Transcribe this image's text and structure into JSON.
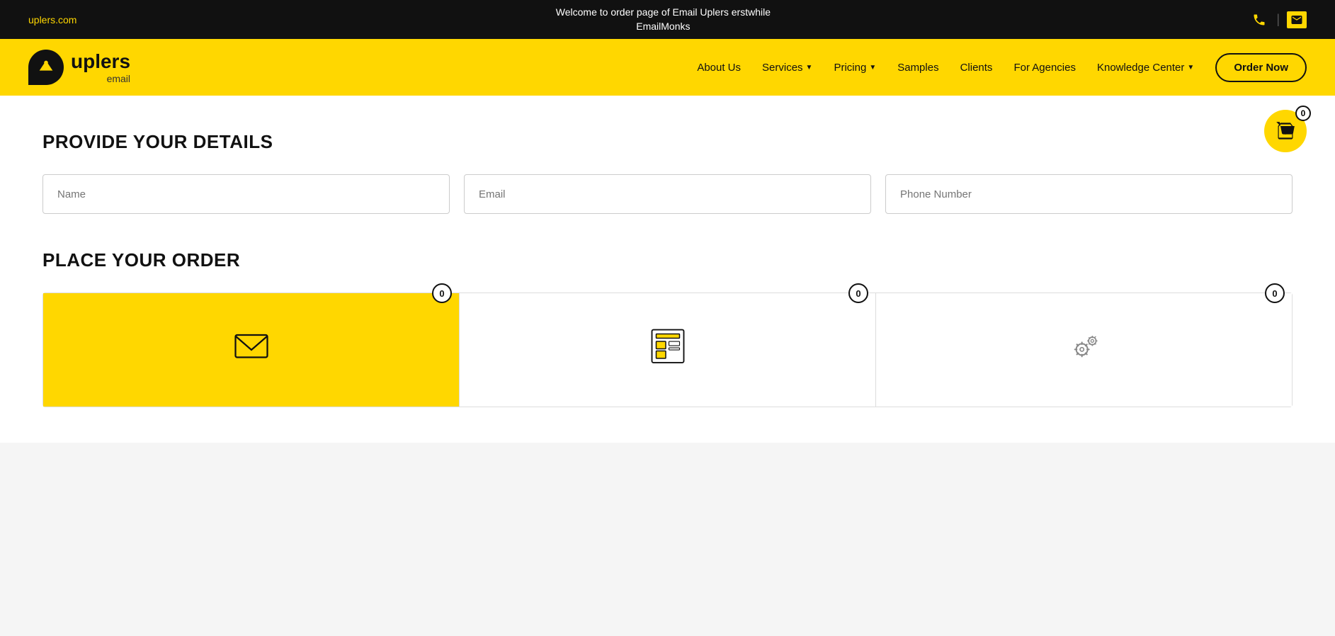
{
  "topBar": {
    "siteLink": "uplers.com",
    "welcomeMessage": "Welcome to order page of Email Uplers erstwhile",
    "brandName": "EmailMonks",
    "phoneIcon": "☎",
    "mailIcon": "✉"
  },
  "header": {
    "logoUplers": "uplers",
    "logoEmail": "email",
    "nav": [
      {
        "label": "About Us",
        "hasDropdown": false
      },
      {
        "label": "Services",
        "hasDropdown": true
      },
      {
        "label": "Pricing",
        "hasDropdown": true
      },
      {
        "label": "Samples",
        "hasDropdown": false
      },
      {
        "label": "Clients",
        "hasDropdown": false
      },
      {
        "label": "For Agencies",
        "hasDropdown": false
      },
      {
        "label": "Knowledge Center",
        "hasDropdown": true
      }
    ],
    "orderNow": "Order Now"
  },
  "cart": {
    "count": "0"
  },
  "provideDetails": {
    "title": "PROVIDE YOUR DETAILS",
    "fields": [
      {
        "placeholder": "Name"
      },
      {
        "placeholder": "Email"
      },
      {
        "placeholder": "Phone Number"
      }
    ]
  },
  "placeOrder": {
    "title": "PLACE YOUR ORDER",
    "cards": [
      {
        "icon": "email",
        "badge": "0",
        "active": true
      },
      {
        "icon": "layout",
        "badge": "0",
        "active": false
      },
      {
        "icon": "gear",
        "badge": "0",
        "active": false
      }
    ]
  }
}
